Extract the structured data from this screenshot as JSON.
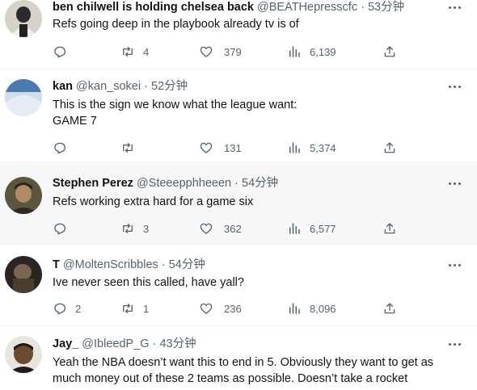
{
  "tweets": [
    {
      "name": "ben chilwell is holding chelsea back",
      "handle": "@BEATHepresscfc",
      "sep": "·",
      "time": "53分钟",
      "text": [
        "Refs going deep in the playbook already tv is of"
      ],
      "replies": "",
      "retweets": "4",
      "likes": "379",
      "views": "6,139",
      "avatar_colors": [
        "#2b2b2b",
        "#c9c3b8"
      ]
    },
    {
      "name": "kan",
      "handle": "@kan_sokei",
      "sep": "·",
      "time": "52分钟",
      "text": [
        "This is the sign we know what the league want:",
        "GAME 7"
      ],
      "replies": "",
      "retweets": "",
      "likes": "131",
      "views": "5,374",
      "avatar_colors": [
        "#3a6ea8",
        "#d8e4f0"
      ]
    },
    {
      "name": "Stephen Perez",
      "handle": "@Steeepphheeen",
      "sep": "·",
      "time": "54分钟",
      "text": [
        "Refs working extra hard for a game six"
      ],
      "replies": "",
      "retweets": "3",
      "likes": "362",
      "views": "6,577",
      "avatar_colors": [
        "#3d3a2c",
        "#8a7a5c"
      ]
    },
    {
      "name": "T",
      "handle": "@MoltenScribbles",
      "sep": "·",
      "time": "54分钟",
      "text": [
        "Ive never seen this called, have yall?"
      ],
      "replies": "2",
      "retweets": "1",
      "likes": "236",
      "views": "8,096",
      "avatar_colors": [
        "#2a2520",
        "#6b5a48"
      ]
    },
    {
      "name": "Jay_",
      "handle": "@IbleedP_G",
      "sep": "·",
      "time": "43分钟",
      "text": [
        "Yeah the NBA doesn’t want this to end in 5. Obviously they want to get as",
        "much money out of these 2 teams as possible. Doesn’t take a rocket"
      ],
      "replies": "",
      "retweets": "",
      "likes": "",
      "views": "",
      "avatar_colors": [
        "#1c1a18",
        "#7a5a40"
      ]
    }
  ],
  "colors": {
    "text": "#0f1419",
    "muted": "#536471",
    "hover_bg": "#f7f7f7",
    "divider": "#eff3f4"
  },
  "icons": {
    "reply": "reply-icon",
    "retweet": "retweet-icon",
    "like": "heart-icon",
    "views": "views-chart-icon",
    "share": "share-icon",
    "more": "more-dots-icon"
  }
}
